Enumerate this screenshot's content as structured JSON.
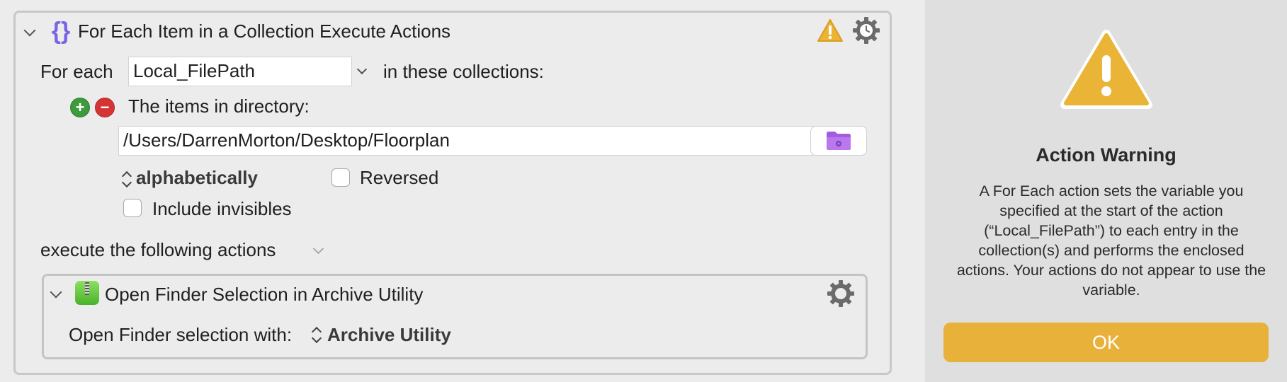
{
  "action": {
    "title": "For Each Item in a Collection Execute Actions",
    "for_each_label": "For each",
    "variable_value": "Local_FilePath",
    "in_collections_label": "in these collections:",
    "collection_label": "The items in directory:",
    "directory_path": "/Users/DarrenMorton/Desktop/Floorplan",
    "sort_order": "alphabetically",
    "reversed_label": "Reversed",
    "include_invisibles_label": "Include invisibles",
    "execute_label": "execute the following actions",
    "add_symbol": "+",
    "remove_symbol": "−"
  },
  "nested_action": {
    "title": "Open Finder Selection in Archive Utility",
    "open_with_label": "Open Finder selection with:",
    "app_value": "Archive Utility"
  },
  "warning": {
    "title": "Action Warning",
    "message": "A For Each action sets the variable you specified at the start of the action (“Local_FilePath”) to each entry in the collection(s) and performs the enclosed actions.  Your actions do not appear to use the variable.",
    "ok_label": "OK"
  },
  "icons": [
    "chevron-down-icon",
    "curly-braces-icon",
    "warning-icon",
    "gear-icon",
    "clock-icon",
    "folder-icon",
    "archive-utility-icon",
    "up-down-arrows-icon",
    "add-icon",
    "remove-icon"
  ],
  "colors": {
    "warning_yellow": "#eab437",
    "ok_button": "#e8b23a",
    "add_green": "#3d9a3d",
    "remove_red": "#d53434",
    "folder_purple": "#a35ce0",
    "braces_purple": "#7b63e8"
  }
}
